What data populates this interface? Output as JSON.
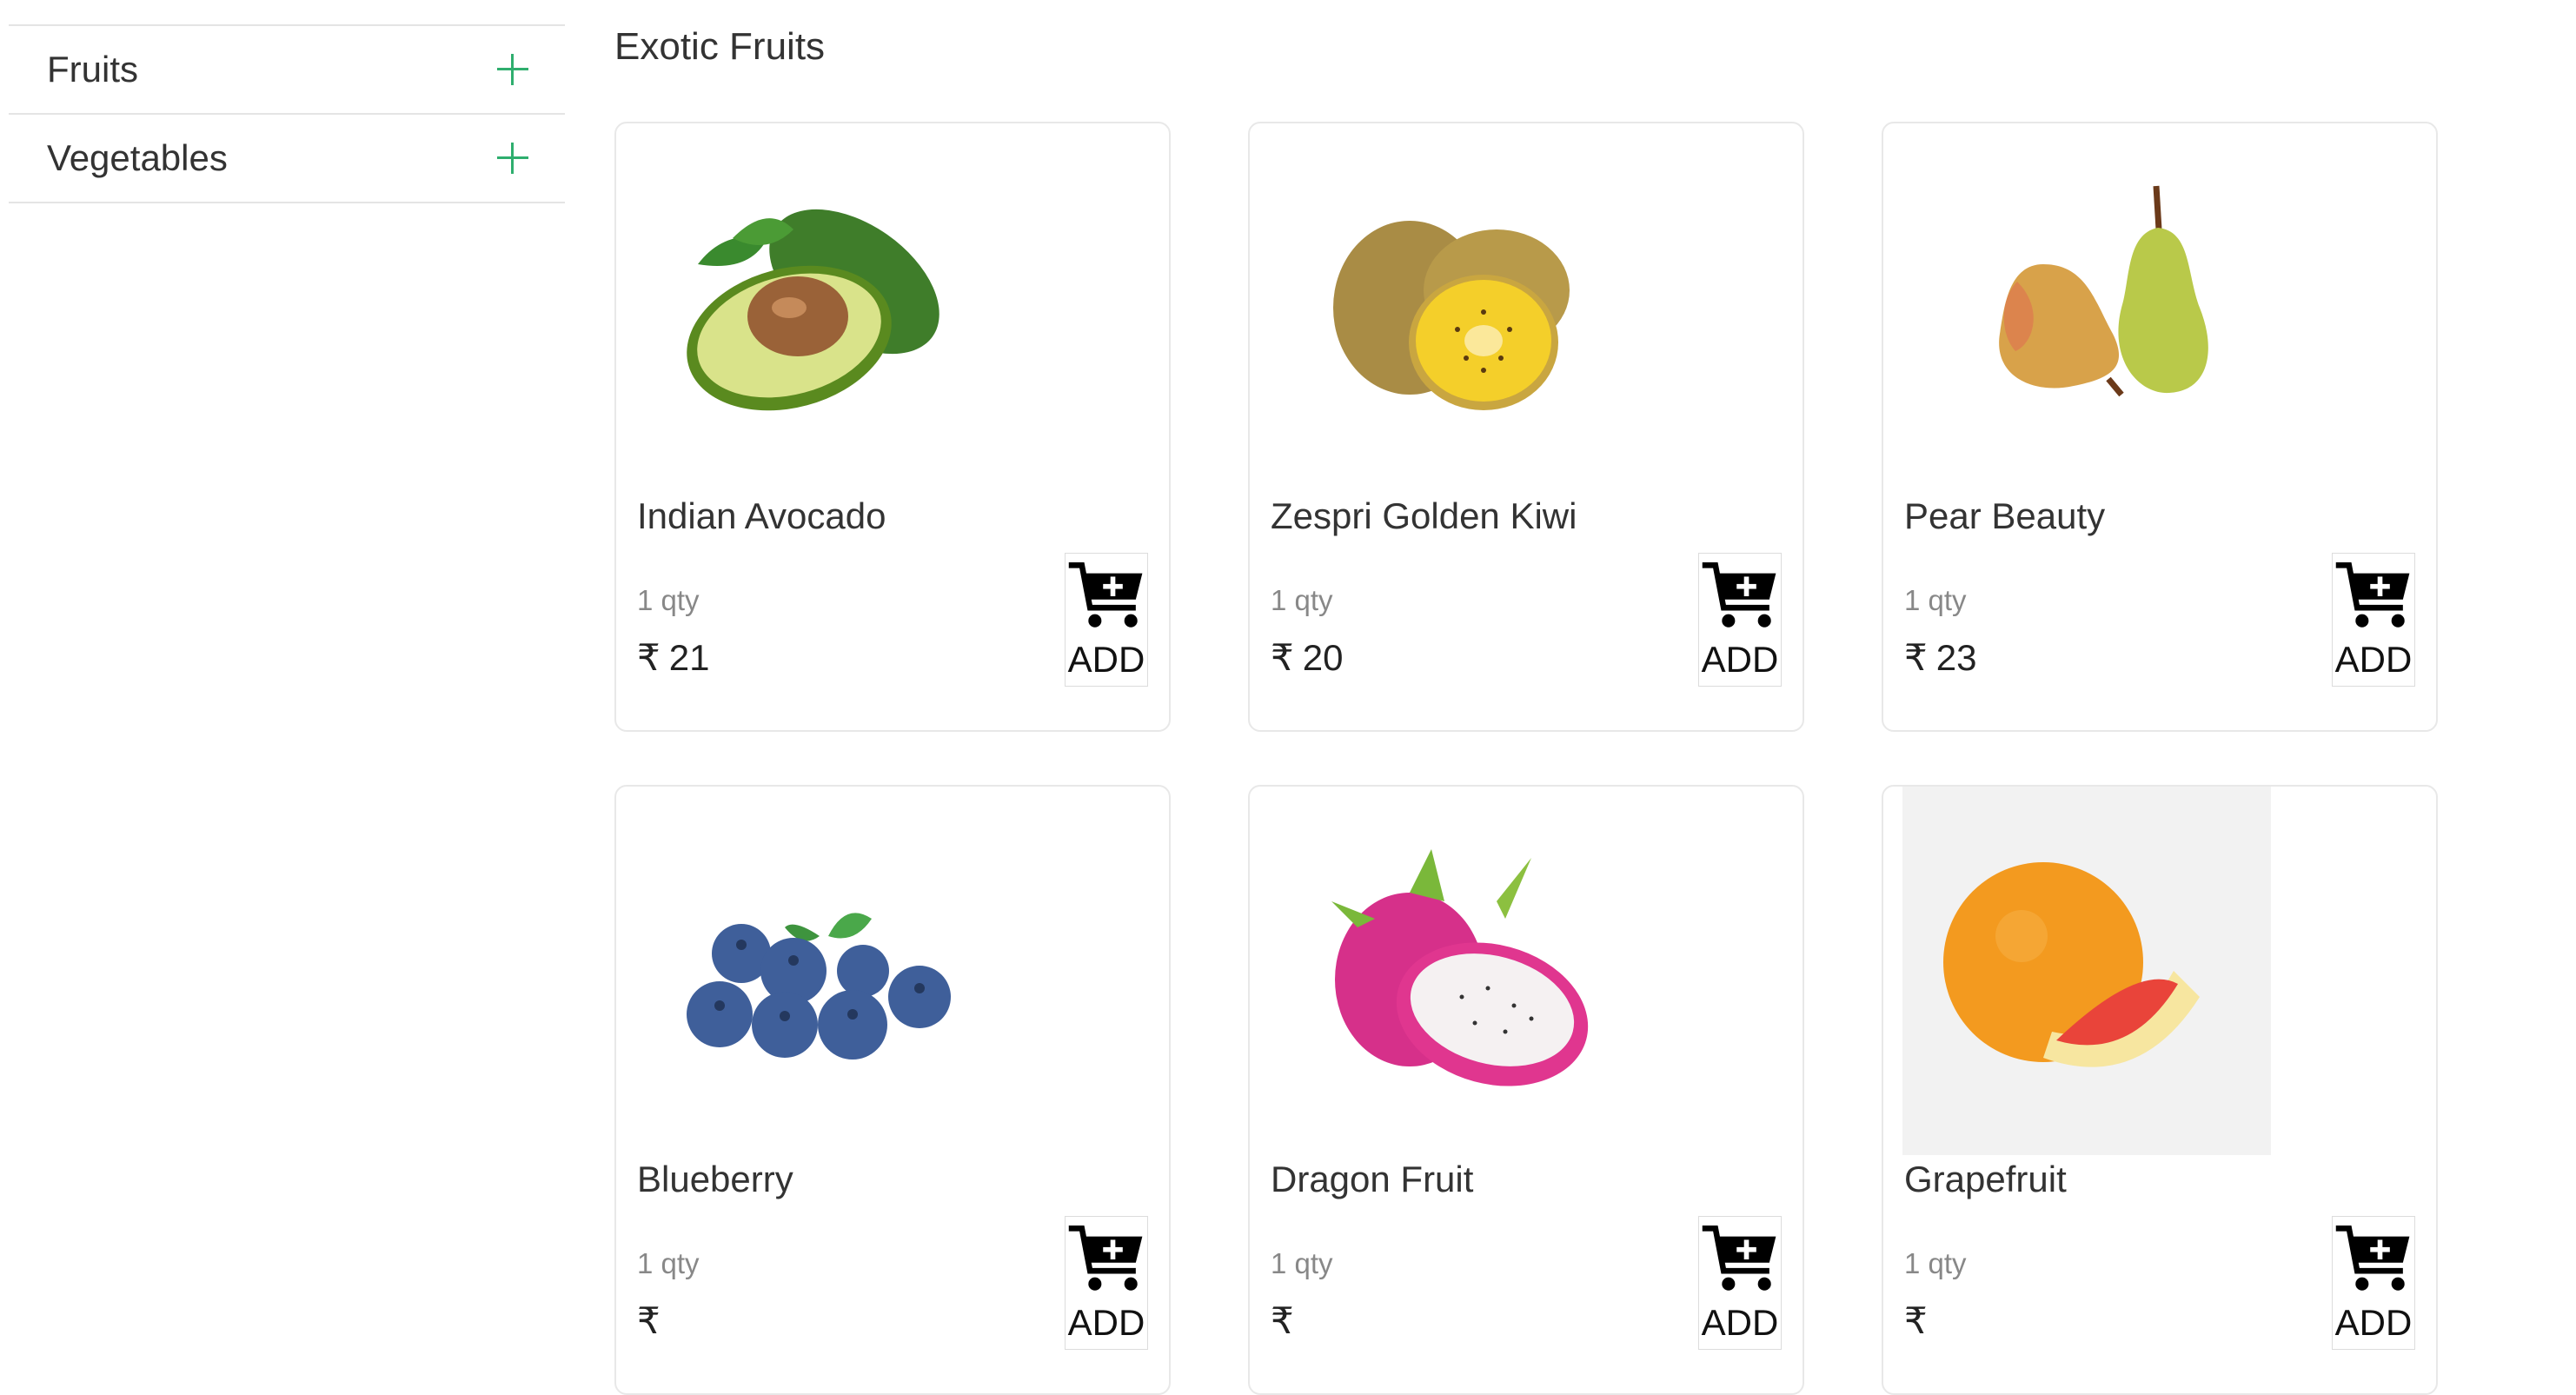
{
  "sidebar": {
    "items": [
      {
        "label": "Fruits",
        "icon": "plus-icon"
      },
      {
        "label": "Vegetables",
        "icon": "plus-icon"
      }
    ]
  },
  "section": {
    "title": "Exotic Fruits"
  },
  "products": [
    {
      "name": "Indian Avocado",
      "qty": "1 qty",
      "currency": "₹",
      "price": "21",
      "add_label": "ADD"
    },
    {
      "name": "Zespri Golden Kiwi",
      "qty": "1 qty",
      "currency": "₹",
      "price": "20",
      "add_label": "ADD"
    },
    {
      "name": "Pear Beauty",
      "qty": "1 qty",
      "currency": "₹",
      "price": "23",
      "add_label": "ADD"
    },
    {
      "name": "Blueberry",
      "qty": "1 qty",
      "currency": "₹",
      "price": "",
      "add_label": "ADD"
    },
    {
      "name": "Dragon Fruit",
      "qty": "1 qty",
      "currency": "₹",
      "price": "",
      "add_label": "ADD"
    },
    {
      "name": "Grapefruit",
      "qty": "1 qty",
      "currency": "₹",
      "price": "",
      "add_label": "ADD"
    }
  ],
  "colors": {
    "accent": "#2fae6e",
    "border": "#e8e8e8"
  }
}
